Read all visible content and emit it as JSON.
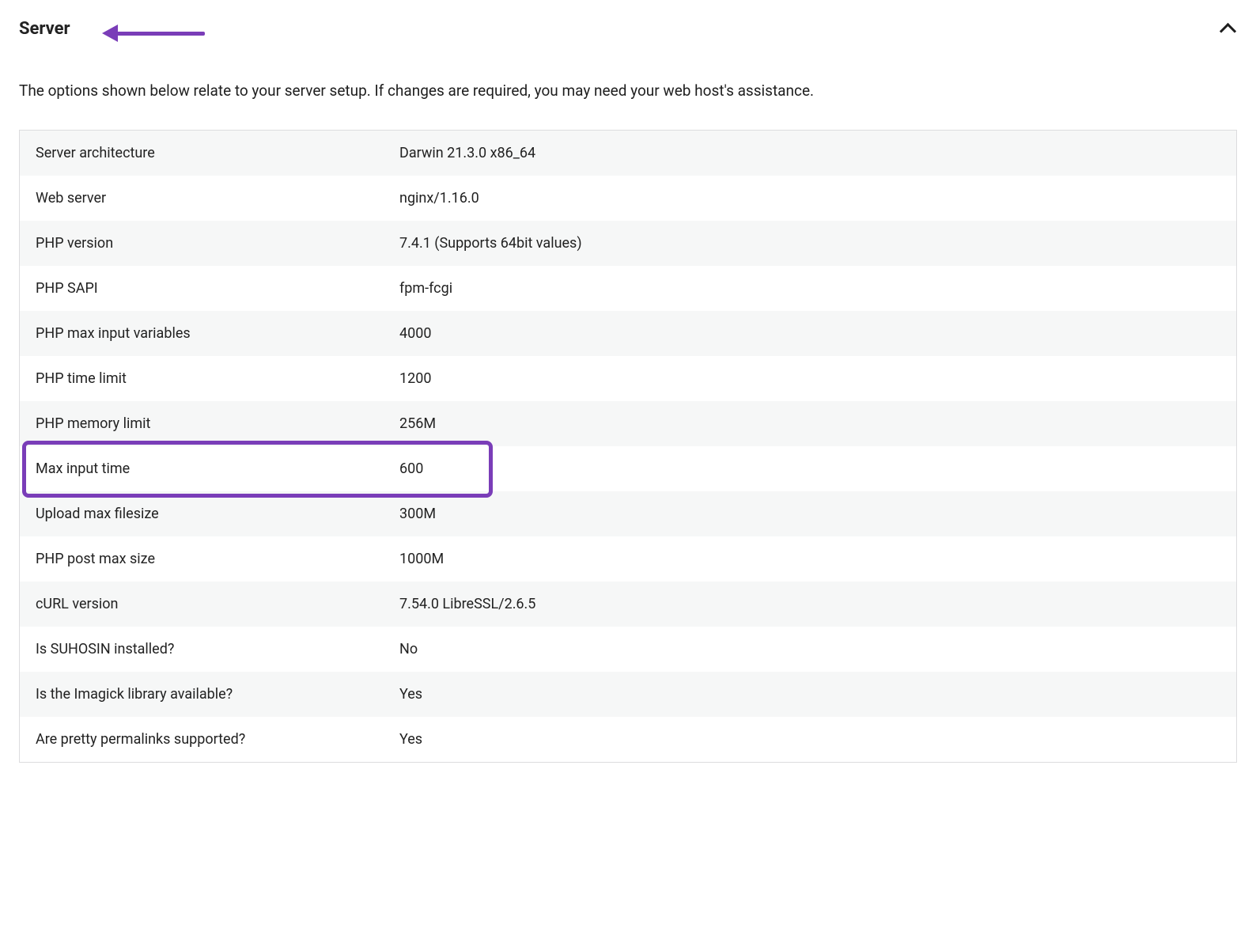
{
  "panel": {
    "title": "Server",
    "description": "The options shown below relate to your server setup. If changes are required, you may need your web host's assistance."
  },
  "rows": [
    {
      "label": "Server architecture",
      "value": "Darwin 21.3.0 x86_64"
    },
    {
      "label": "Web server",
      "value": "nginx/1.16.0"
    },
    {
      "label": "PHP version",
      "value": "7.4.1 (Supports 64bit values)"
    },
    {
      "label": "PHP SAPI",
      "value": "fpm-fcgi"
    },
    {
      "label": "PHP max input variables",
      "value": "4000"
    },
    {
      "label": "PHP time limit",
      "value": "1200"
    },
    {
      "label": "PHP memory limit",
      "value": "256M"
    },
    {
      "label": "Max input time",
      "value": "600"
    },
    {
      "label": "Upload max filesize",
      "value": "300M"
    },
    {
      "label": "PHP post max size",
      "value": "1000M"
    },
    {
      "label": "cURL version",
      "value": "7.54.0 LibreSSL/2.6.5"
    },
    {
      "label": "Is SUHOSIN installed?",
      "value": "No"
    },
    {
      "label": "Is the Imagick library available?",
      "value": "Yes"
    },
    {
      "label": "Are pretty permalinks supported?",
      "value": "Yes"
    }
  ],
  "annotations": {
    "highlight_row_index": 6,
    "arrow_color": "#7a3db8"
  }
}
